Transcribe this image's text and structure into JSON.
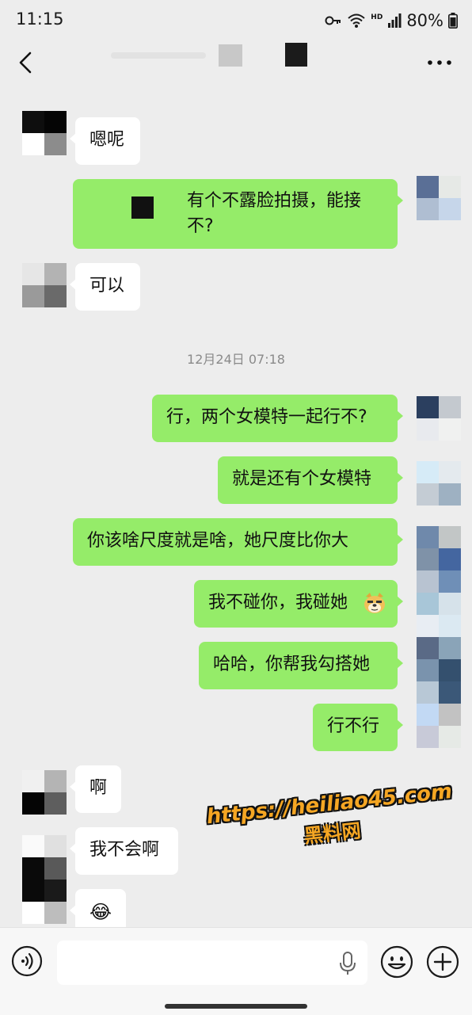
{
  "status_bar": {
    "time": "11:15",
    "network_label": "HD",
    "battery": "80%",
    "icons": [
      "key-icon",
      "wifi-icon",
      "signal-icon",
      "battery-icon"
    ]
  },
  "header": {
    "icons": [
      "back-icon",
      "more-icon"
    ]
  },
  "messages": {
    "m1": "嗯呢",
    "m2": "有个不露脸拍摄，能接不?",
    "m3": "可以",
    "timestamp": "12月24日 07:18",
    "m4": "行，两个女模特一起行不?",
    "m5": "就是还有个女模特",
    "m6": "你该啥尺度就是啥，她尺度比你大",
    "m7": "我不碰你，我碰她",
    "m7_emoji": "doge-emoji",
    "m8": "哈哈，你帮我勾搭她",
    "m9": "行不行",
    "m10": "啊",
    "m11": "我不会啊",
    "m12": "😂"
  },
  "watermark": {
    "url": "https://heiliao45.com",
    "name": "黑料网"
  },
  "input_bar": {
    "icons": [
      "voice-icon",
      "mic-icon",
      "emoji-icon",
      "plus-icon"
    ]
  },
  "colors": {
    "background": "#ededed",
    "outgoing_bubble": "#95ec69",
    "incoming_bubble": "#ffffff",
    "watermark": "#f5a623"
  }
}
